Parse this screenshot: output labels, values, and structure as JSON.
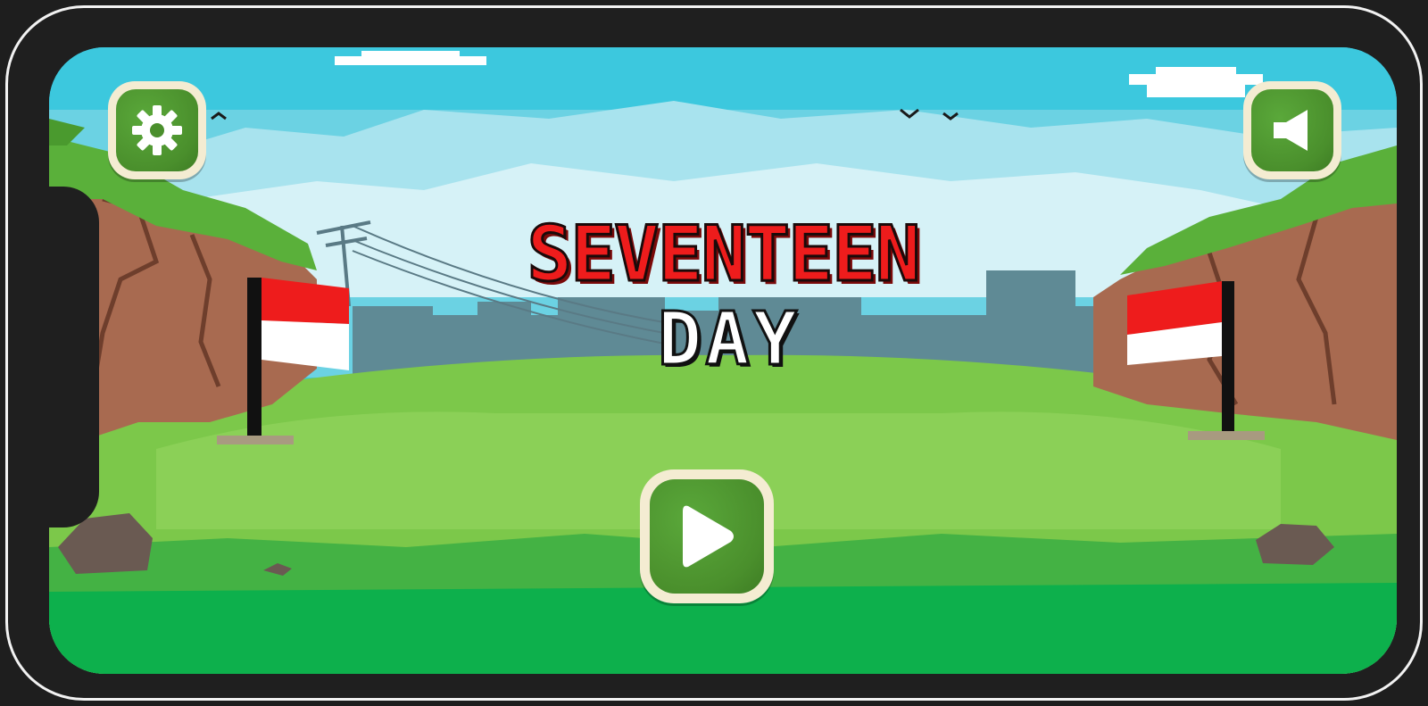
{
  "game": {
    "title_line1": "SEVENTEEN",
    "title_line2": "DAY"
  },
  "buttons": {
    "settings_icon": "gear-icon",
    "sound_icon": "speaker-icon",
    "play_icon": "play-icon"
  },
  "colors": {
    "sky": "#3cc8de",
    "grass": "#7cc84a",
    "flag_red": "#ee1c1c",
    "flag_white": "#ffffff",
    "button_green": "#4a8f2c",
    "button_frame": "#f4ecd2",
    "title_red": "#ee1c1c"
  }
}
